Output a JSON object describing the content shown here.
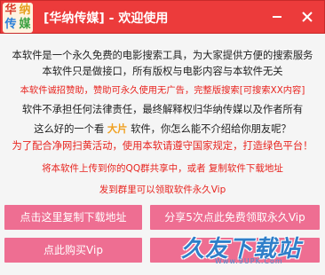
{
  "window": {
    "logo": [
      "华",
      "纳",
      "传",
      "媒"
    ],
    "title": "[华纳传媒] - 欢迎使用",
    "minimize_glyph": "—",
    "close_glyph": "✕"
  },
  "message": {
    "line1": "本软件是一个永久免费的电影搜索工具，为大家提供方便的搜索服务",
    "line2": "本软件只是做接口，所有版权与电影内容与本软件无关",
    "line3": "本软件诚招赞助，赞助可永久使用无广告，完整版搜索[可搜索XX内容]",
    "line4": "软件不承担任何法律责任，最终解释权归华纳传媒以及作者所有",
    "line5_a": "这么好的一个看",
    "line5_highlight": "大片",
    "line5_b": "软件，你怎么能不介绍给你朋友呢？",
    "line6": "为了配合净网扫黄活动，使用本软请遵守国家规定，打造绿色平台！",
    "line7": "将本软件上传到你的QQ群共享中，或者 复制软件下载地址",
    "line8": "发到群里可以领取软件永久Vip"
  },
  "buttons": {
    "copy_download": "点击这里复制下载地址",
    "share_vip": "分享5次点此免费领取永久Vip",
    "buy_vip": "点此购买Vip",
    "fourth": ""
  },
  "watermark": {
    "main": "久友下载站",
    "sub": "Www.9UPK.Com"
  },
  "colors": {
    "titlebar": "#ec3b3b",
    "button": "#ee6e92",
    "red_text": "#e8241f",
    "highlight": "#f0a020"
  }
}
